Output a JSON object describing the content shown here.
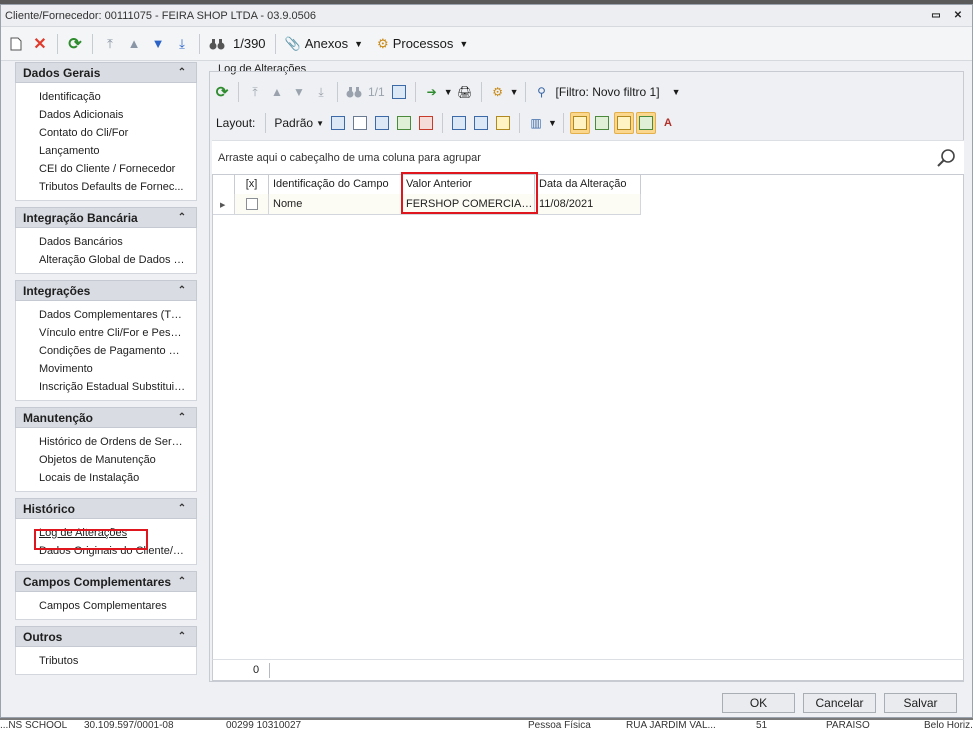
{
  "window": {
    "title": "Cliente/Fornecedor: 00111075 - FEIRA SHOP LTDA - 03.9.0506"
  },
  "toolbar": {
    "record_position": "1/390",
    "attachments_label": "Anexos",
    "processes_label": "Processos"
  },
  "sidebar": {
    "groups": [
      {
        "title": "Dados Gerais",
        "items": [
          "Identificação",
          "Dados Adicionais",
          "Contato do Cli/For",
          "Lançamento",
          "CEI do Cliente / Fornecedor",
          "Tributos Defaults de Fornec..."
        ]
      },
      {
        "title": "Integração Bancária",
        "items": [
          "Dados Bancários",
          "Alteração Global de Dados B..."
        ]
      },
      {
        "title": "Integrações",
        "items": [
          "Dados Complementares (TO...",
          "Vínculo entre Cli/For e Pessoa",
          "Condições de Pagamento De...",
          "Movimento",
          "Inscrição Estadual Substituiç..."
        ]
      },
      {
        "title": "Manutenção",
        "items": [
          "Histórico de Ordens de Servi...",
          "Objetos de Manutenção",
          "Locais de Instalação"
        ]
      },
      {
        "title": "Histórico",
        "items": [
          "Log de Alterações",
          "Dados Originais do Cliente/F..."
        ]
      },
      {
        "title": "Campos Complementares",
        "items": [
          "Campos Complementares"
        ]
      },
      {
        "title": "Outros",
        "items": [
          "Tributos"
        ]
      }
    ]
  },
  "panel": {
    "title": "Log de Alterações",
    "record_position": "1/1",
    "filter_label": "[Filtro: Novo filtro 1]",
    "layout_label": "Layout:",
    "layout_value": "Padrão",
    "group_hint": "Arraste aqui o cabeçalho de uma coluna para agrupar",
    "columns": [
      "[x]",
      "Identificação do Campo",
      "Valor Anterior",
      "Data da Alteração"
    ],
    "rows": [
      {
        "field": "Nome",
        "previous_value": "FERSHOP COMERCIAL ...",
        "date": "11/08/2021"
      }
    ],
    "footer_count": "0"
  },
  "buttons": {
    "ok": "OK",
    "cancel": "Cancelar",
    "save": "Salvar"
  },
  "background_row": [
    "...NS SCHOOL",
    "30.109.597/0001-08",
    "00299 10310027",
    "Pessoa Física",
    "RUA JARDIM VAL...",
    "51",
    "PARAISO",
    "Belo Horiz..."
  ]
}
